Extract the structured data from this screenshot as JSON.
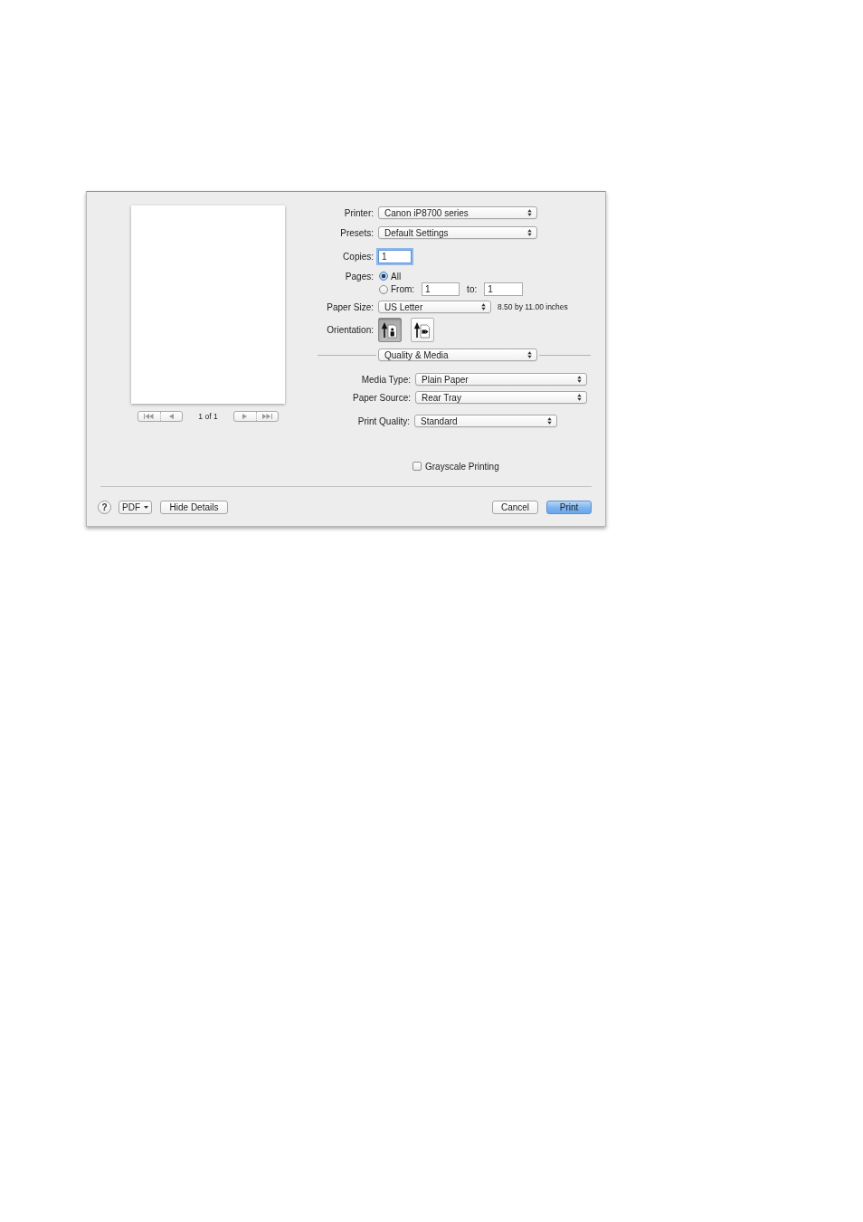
{
  "preview": {
    "page_indicator": "1 of 1",
    "nav_buttons": [
      {
        "kind": "first",
        "disabled": true
      },
      {
        "kind": "previous",
        "disabled": true
      },
      {
        "kind": "next",
        "disabled": true
      },
      {
        "kind": "last",
        "disabled": true
      }
    ]
  },
  "printer": {
    "label": "Printer:",
    "value": "Canon iP8700 series"
  },
  "presets": {
    "label": "Presets:",
    "value": "Default Settings"
  },
  "copies": {
    "label": "Copies:",
    "value": "1",
    "focused": true
  },
  "pages": {
    "label": "Pages:",
    "options": [
      {
        "kind": "all",
        "label": "All",
        "selected": true
      },
      {
        "kind": "range",
        "label": "From:",
        "selected": false,
        "from": "1",
        "to_label": "to:",
        "to": "1"
      }
    ]
  },
  "paper_size": {
    "label": "Paper Size:",
    "value": "US Letter",
    "dimensions": "8.50 by 11.00 inches"
  },
  "orientation": {
    "label": "Orientation:",
    "options": [
      {
        "kind": "portrait",
        "selected": true
      },
      {
        "kind": "landscape",
        "selected": false
      }
    ]
  },
  "panel_menu": {
    "value": "Quality & Media"
  },
  "media_type": {
    "label": "Media Type:",
    "value": "Plain Paper"
  },
  "paper_source": {
    "label": "Paper Source:",
    "value": "Rear Tray"
  },
  "print_quality": {
    "label": "Print Quality:",
    "value": "Standard"
  },
  "grayscale": {
    "label": "Grayscale Printing",
    "checked": false
  },
  "footer": {
    "help": "?",
    "pdf": "PDF",
    "hide_details": "Hide Details",
    "buttons": [
      {
        "label": "Cancel",
        "default": false
      },
      {
        "label": "Print",
        "default": true
      }
    ]
  }
}
